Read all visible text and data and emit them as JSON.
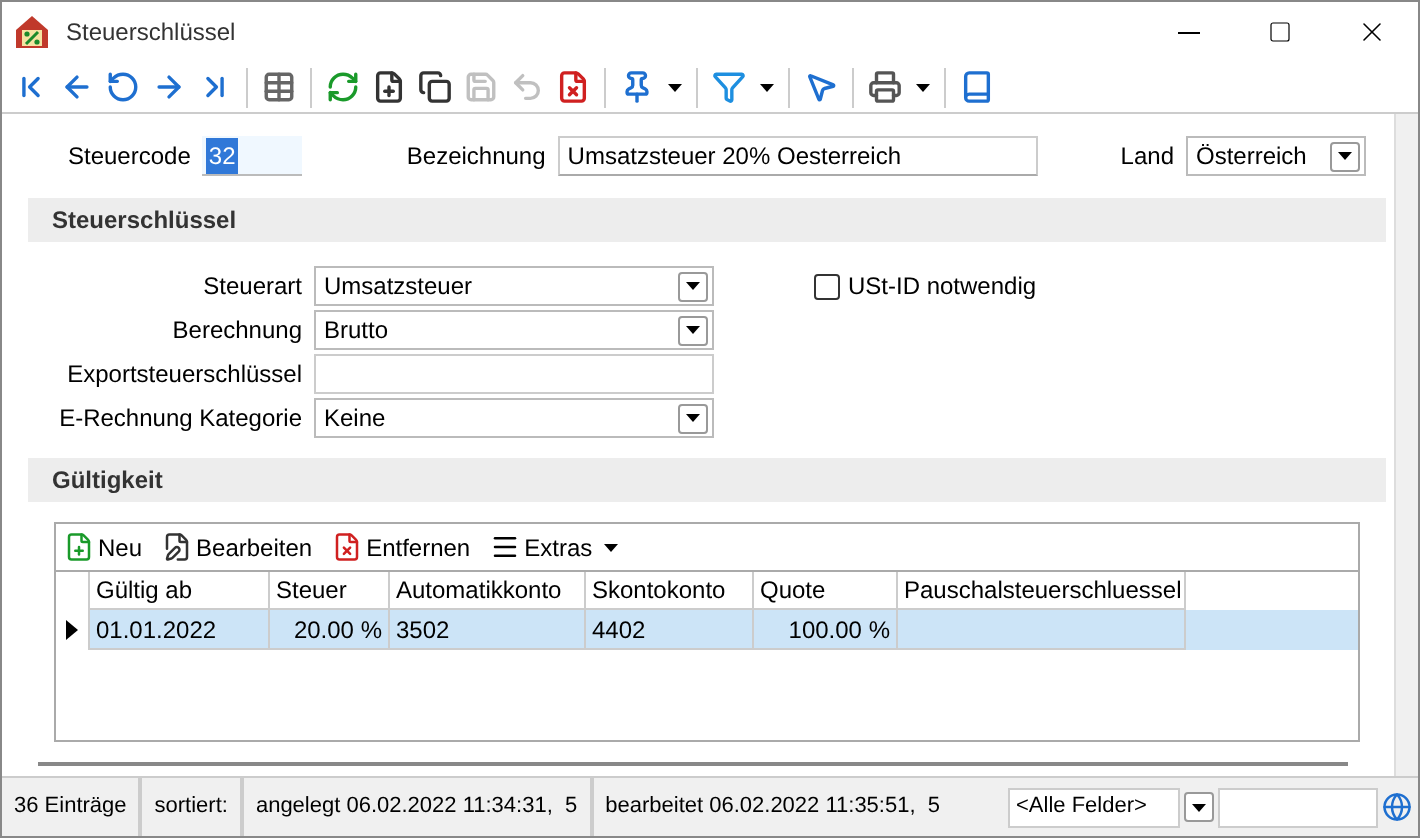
{
  "window": {
    "title": "Steuerschlüssel"
  },
  "toolbar": [
    {
      "kind": "first",
      "disabled": false
    },
    {
      "kind": "prev",
      "disabled": false
    },
    {
      "kind": "back",
      "disabled": false
    },
    {
      "kind": "next",
      "disabled": false
    },
    {
      "kind": "last",
      "disabled": false
    },
    {
      "kind": "sep"
    },
    {
      "kind": "table",
      "disabled": false
    },
    {
      "kind": "sep"
    },
    {
      "kind": "refresh",
      "disabled": false
    },
    {
      "kind": "new",
      "disabled": false
    },
    {
      "kind": "copy",
      "disabled": false
    },
    {
      "kind": "save",
      "disabled": true
    },
    {
      "kind": "undo",
      "disabled": true
    },
    {
      "kind": "delete",
      "disabled": false
    },
    {
      "kind": "sep"
    },
    {
      "kind": "pin",
      "disabled": false
    },
    {
      "kind": "drop"
    },
    {
      "kind": "sep"
    },
    {
      "kind": "filter",
      "disabled": false
    },
    {
      "kind": "drop"
    },
    {
      "kind": "sep"
    },
    {
      "kind": "select",
      "disabled": false
    },
    {
      "kind": "sep"
    },
    {
      "kind": "print",
      "disabled": false
    },
    {
      "kind": "drop"
    },
    {
      "kind": "sep"
    },
    {
      "kind": "book",
      "disabled": false
    }
  ],
  "header": {
    "steuercode": {
      "label": "Steuercode",
      "value": "32"
    },
    "bezeichnung": {
      "label": "Bezeichnung",
      "value": "Umsatzsteuer 20% Oesterreich"
    },
    "land": {
      "label": "Land",
      "value": "Österreich"
    }
  },
  "section1": {
    "title": "Steuerschlüssel",
    "fields": [
      {
        "label": "Steuerart",
        "value": "Umsatzsteuer",
        "kind": "select"
      },
      {
        "label": "Berechnung",
        "value": "Brutto",
        "kind": "select"
      },
      {
        "label": "Exportsteuerschlüssel",
        "kind": "text"
      },
      {
        "label": "E-Rechnung Kategorie",
        "value": "Keine",
        "kind": "select"
      }
    ],
    "checkbox": {
      "label": "USt-ID notwendig",
      "checked": false
    }
  },
  "section2": {
    "title": "Gültigkeit",
    "actions": [
      {
        "label": "Neu",
        "kind": "new"
      },
      {
        "label": "Bearbeiten",
        "kind": "edit"
      },
      {
        "label": "Entfernen",
        "kind": "delete"
      },
      {
        "label": "Extras",
        "kind": "menu"
      }
    ],
    "table": {
      "columns": [
        "Gültig ab",
        "Steuer",
        "Automatikkonto",
        "Skontokonto",
        "Quote",
        "Pauschalsteuerschluessel"
      ],
      "rows": [
        {
          "cells": [
            "01.01.2022",
            "20.00 %",
            "3502",
            "4402",
            "100.00 %",
            ""
          ],
          "selected": true
        }
      ]
    }
  },
  "status_bar": {
    "count": "36 Einträge",
    "sorted": "sortiert:",
    "created": "angelegt 06.02.2022 11:34:31,  5",
    "edited": "bearbeitet 06.02.2022 11:35:51,  5",
    "filter": "<Alle Felder>"
  }
}
